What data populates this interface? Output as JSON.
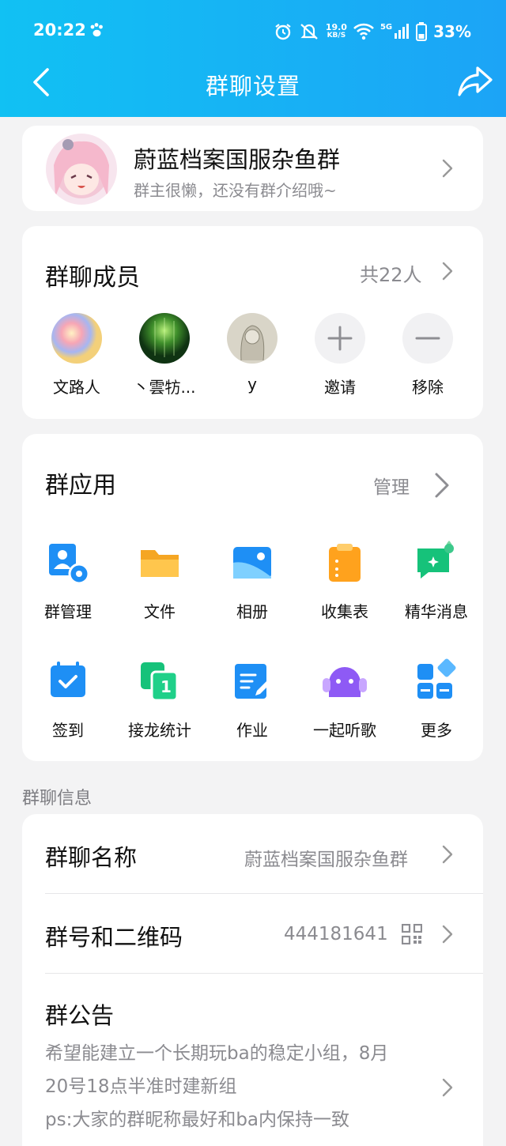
{
  "status_bar": {
    "time": "20:22",
    "speed_value": "19.0",
    "speed_unit": "KB/S",
    "network": "5G",
    "battery": "33%"
  },
  "nav": {
    "title": "群聊设置"
  },
  "group": {
    "name": "蔚蓝档案国服杂鱼群",
    "description": "群主很懒，还没有群介绍哦~"
  },
  "members": {
    "title": "群聊成员",
    "count": "共22人",
    "items": [
      {
        "name": "文路人"
      },
      {
        "name": "丶雲牥..."
      },
      {
        "name": "y"
      },
      {
        "name": "邀请"
      },
      {
        "name": "移除"
      }
    ]
  },
  "apps": {
    "title": "群应用",
    "manage": "管理",
    "items": [
      {
        "name": "群管理",
        "icon": "group-manage-icon"
      },
      {
        "name": "文件",
        "icon": "folder-icon"
      },
      {
        "name": "相册",
        "icon": "album-icon"
      },
      {
        "name": "收集表",
        "icon": "form-icon"
      },
      {
        "name": "精华消息",
        "icon": "essence-message-icon"
      },
      {
        "name": "签到",
        "icon": "checkin-icon"
      },
      {
        "name": "接龙统计",
        "icon": "relay-icon"
      },
      {
        "name": "作业",
        "icon": "homework-icon"
      },
      {
        "name": "一起听歌",
        "icon": "listen-together-icon"
      },
      {
        "name": "更多",
        "icon": "more-apps-icon"
      }
    ]
  },
  "info": {
    "section_label": "群聊信息",
    "name_label": "群聊名称",
    "name_value": "蔚蓝档案国服杂鱼群",
    "number_label": "群号和二维码",
    "number_value": "444181641",
    "notice_label": "群公告",
    "notice_lines": [
      "希望能建立一个长期玩ba的稳定小组，8月",
      "20号18点半准时建新组",
      "ps:大家的群昵称最好和ba内保持一致"
    ]
  },
  "colors": {
    "header_start": "#11c1f3",
    "header_end": "#1ca4f6",
    "accent": "#1e8ff5"
  }
}
